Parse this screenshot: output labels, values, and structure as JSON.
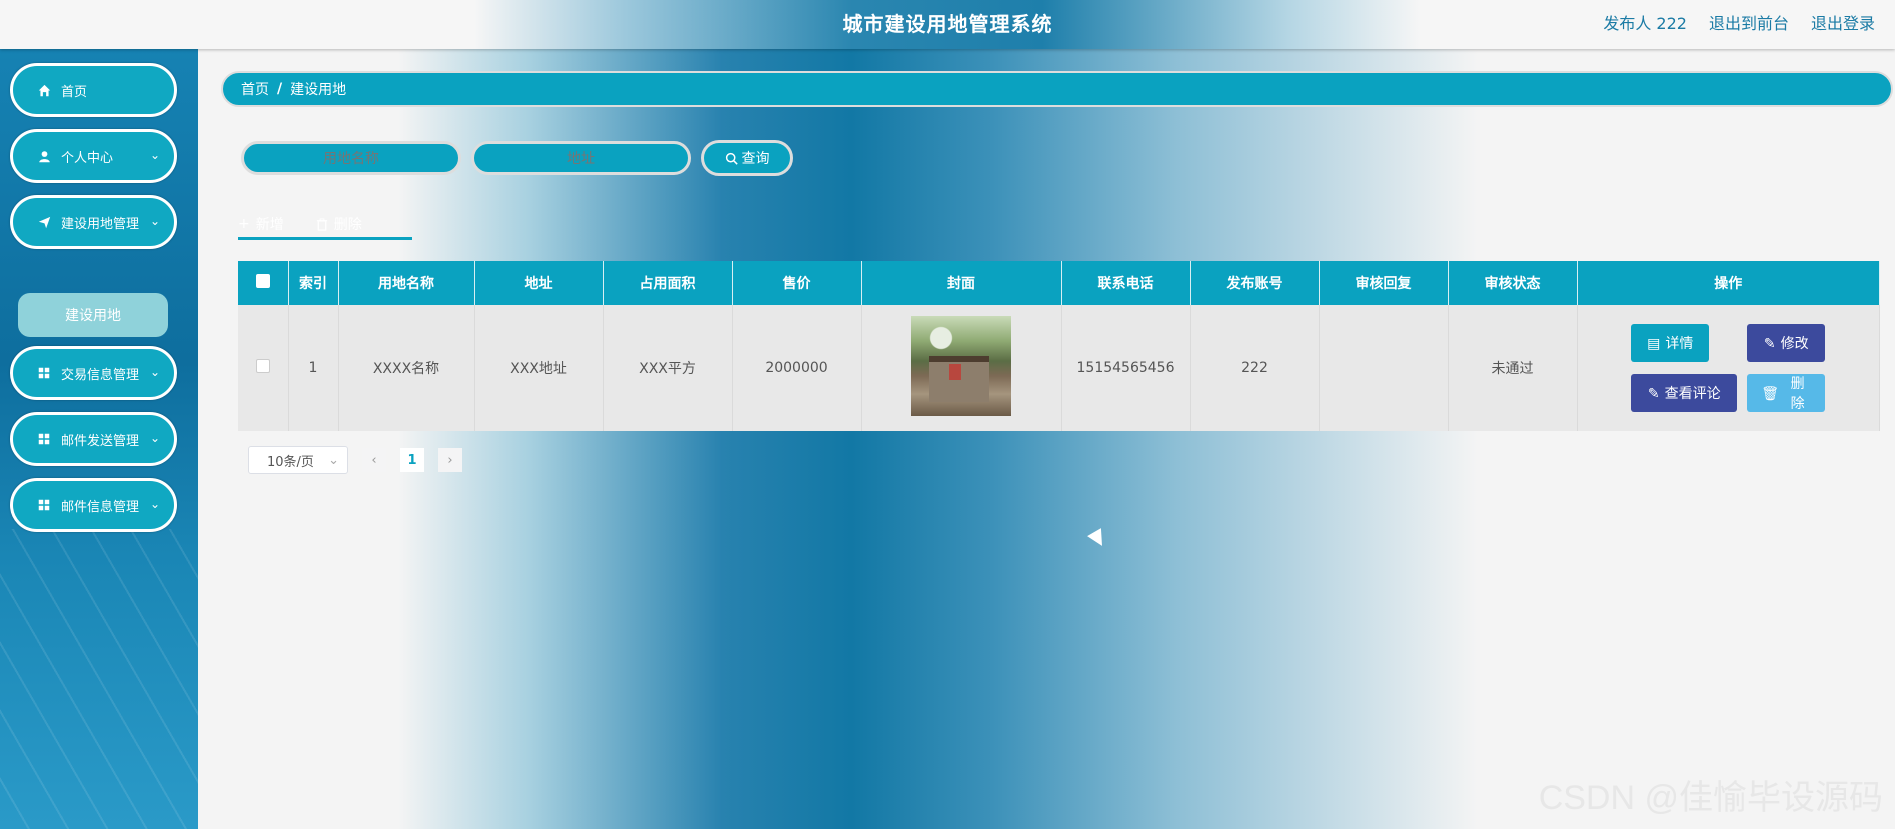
{
  "header": {
    "title": "城市建设用地管理系统",
    "user_label": "发布人 222",
    "back_label": "退出到前台",
    "logout_label": "退出登录"
  },
  "sidebar": {
    "items": [
      {
        "label": "首页",
        "icon": "home-icon"
      },
      {
        "label": "个人中心",
        "icon": "user-icon"
      },
      {
        "label": "建设用地管理",
        "icon": "send-icon"
      },
      {
        "label": "交易信息管理",
        "icon": "grid-icon"
      },
      {
        "label": "邮件发送管理",
        "icon": "grid-icon"
      },
      {
        "label": "邮件信息管理",
        "icon": "grid-icon"
      }
    ],
    "submenu": "建设用地"
  },
  "breadcrumb": {
    "home": "首页",
    "sep": "/",
    "current": "建设用地"
  },
  "search": {
    "name_placeholder": "用地名称",
    "address_placeholder": "地址",
    "button": "查询"
  },
  "actions": {
    "add": "新增",
    "delete": "删除"
  },
  "table": {
    "headers": [
      "索引",
      "用地名称",
      "地址",
      "占用面积",
      "售价",
      "封面",
      "联系电话",
      "发布账号",
      "审核回复",
      "审核状态",
      "操作"
    ],
    "rows": [
      {
        "index": "1",
        "name": "XXXX名称",
        "address": "XXX地址",
        "area": "XXX平方",
        "price": "2000000",
        "phone": "15154565456",
        "account": "222",
        "reply": "",
        "status": "未通过"
      }
    ],
    "ops": {
      "detail": "详情",
      "edit": "修改",
      "review": "查看评论",
      "delete": "删除"
    }
  },
  "pager": {
    "page_size": "10条/页",
    "current": "1"
  },
  "watermark": "CSDN @佳愉毕设源码"
}
